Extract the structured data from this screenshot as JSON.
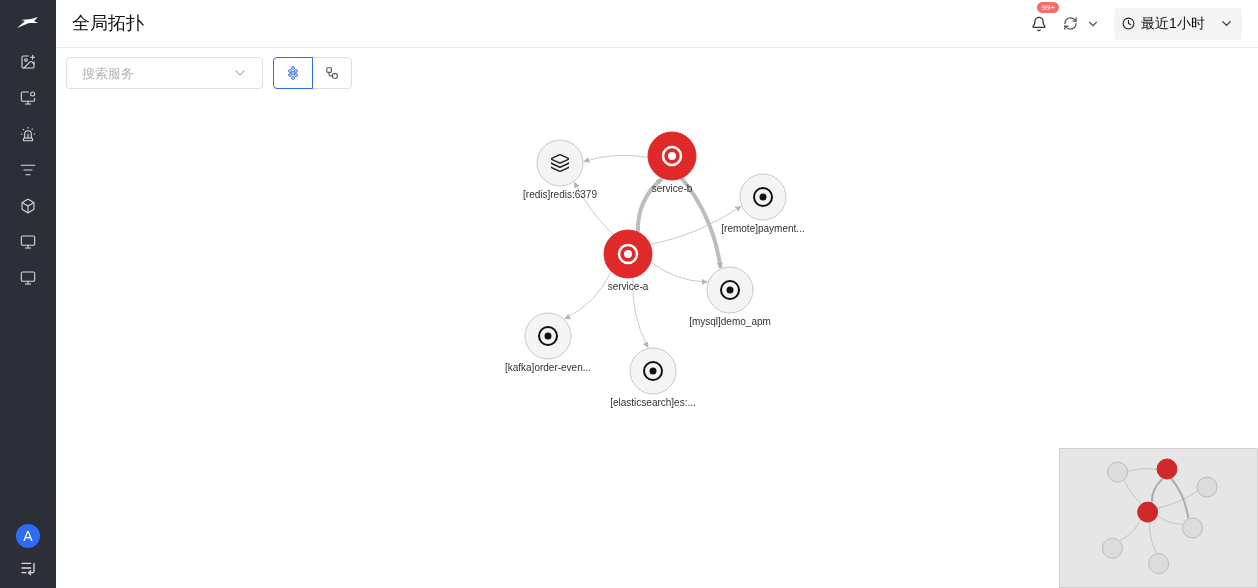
{
  "header": {
    "title": "全局拓扑",
    "notifications": {
      "badge": "99+"
    },
    "time_range": {
      "label": "最近1小时"
    }
  },
  "avatar": {
    "initial": "A"
  },
  "toolbar": {
    "search": {
      "placeholder": "搜索服务"
    },
    "views": [
      {
        "kind": "graph",
        "selected": true
      },
      {
        "kind": "tree",
        "selected": false
      }
    ]
  },
  "graph": {
    "nodes": [
      {
        "label": "service-b",
        "kind": "service"
      },
      {
        "label": "[redis]redis:6379",
        "kind": "cache"
      },
      {
        "label": "[remote]payment...",
        "kind": "resource"
      },
      {
        "label": "service-a",
        "kind": "service"
      },
      {
        "label": "[mysql]demo_apm",
        "kind": "resource"
      },
      {
        "label": "[kafka]order-even...",
        "kind": "resource"
      },
      {
        "label": "[elasticsearch]es:...",
        "kind": "resource"
      }
    ],
    "edges": [
      {
        "emphasized": false
      },
      {
        "emphasized": false
      },
      {
        "emphasized": true
      },
      {
        "emphasized": true
      },
      {
        "emphasized": false
      },
      {
        "emphasized": false
      },
      {
        "emphasized": false
      },
      {
        "emphasized": false
      }
    ]
  }
}
